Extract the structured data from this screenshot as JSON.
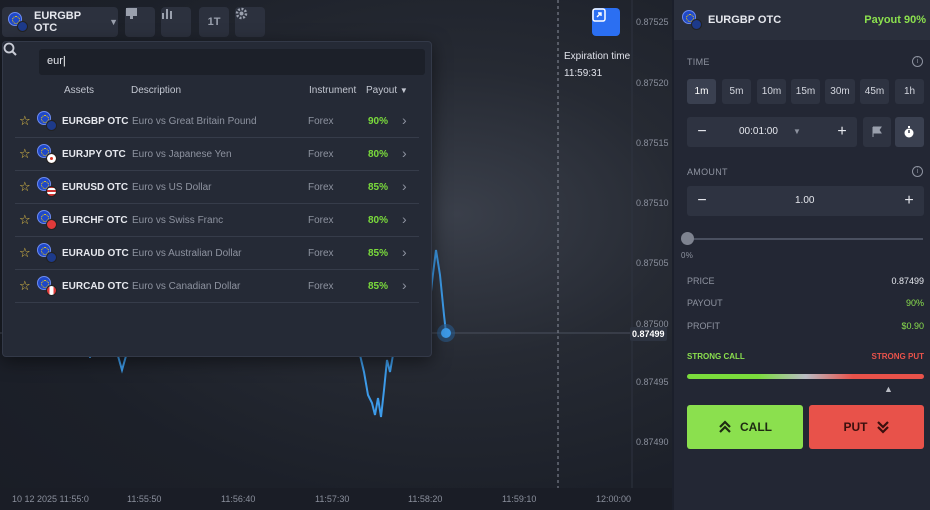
{
  "toolbar": {
    "asset_label": "EURGBP OTC",
    "timeframe_label": "1T"
  },
  "chart": {
    "expiration_title": "Expiration time",
    "expiration_time": "11:59:31",
    "current_price": "0.87499",
    "price_ticks": [
      "0.87525",
      "0.87520",
      "0.87515",
      "0.87510",
      "0.87505",
      "0.87500",
      "0.87495",
      "0.87490"
    ],
    "time_ticks": [
      "10 12 2025 11:55:0",
      "11:55:50",
      "11:56:40",
      "11:57:30",
      "11:58:20",
      "11:59:10",
      "12:00:00"
    ],
    "line_color": "#3d9be9"
  },
  "dropdown": {
    "search_value": "eur",
    "headers": {
      "assets": "Assets",
      "description": "Description",
      "instrument": "Instrument",
      "payout": "Payout"
    },
    "rows": [
      {
        "asset": "EURGBP OTC",
        "description": "Euro vs Great Britain Pound",
        "instrument": "Forex",
        "payout": "90%",
        "flag2": "#1d3a8a"
      },
      {
        "asset": "EURJPY OTC",
        "description": "Euro vs Japanese Yen",
        "instrument": "Forex",
        "payout": "80%",
        "flag2": "#ffffff"
      },
      {
        "asset": "EURUSD OTC",
        "description": "Euro vs US Dollar",
        "instrument": "Forex",
        "payout": "85%",
        "flag2": "#3c5ec9"
      },
      {
        "asset": "EURCHF OTC",
        "description": "Euro vs Swiss Franc",
        "instrument": "Forex",
        "payout": "80%",
        "flag2": "#e03a3a"
      },
      {
        "asset": "EURAUD OTC",
        "description": "Euro vs Australian Dollar",
        "instrument": "Forex",
        "payout": "85%",
        "flag2": "#1d3a8a"
      },
      {
        "asset": "EURCAD OTC",
        "description": "Euro vs Canadian Dollar",
        "instrument": "Forex",
        "payout": "85%",
        "flag2": "#e03a3a"
      }
    ]
  },
  "panel": {
    "asset": "EURGBP OTC",
    "payout": "Payout 90%",
    "time_label": "TIME",
    "timeframes": [
      "1m",
      "5m",
      "10m",
      "15m",
      "30m",
      "45m",
      "1h"
    ],
    "active_timeframe": "1m",
    "time_value": "00:01:00",
    "amount_label": "AMOUNT",
    "amount_value": "1.00",
    "slider_value": "0%",
    "price_label": "PRICE",
    "price_value": "0.87499",
    "payout_label": "PAYOUT",
    "payout_value": "90%",
    "profit_label": "PROFIT",
    "profit_value": "$0.90",
    "strong_call": "STRONG CALL",
    "strong_put": "STRONG PUT",
    "call_label": "CALL",
    "put_label": "PUT",
    "accent_green": "#8be04e",
    "accent_red": "#e8524a"
  }
}
